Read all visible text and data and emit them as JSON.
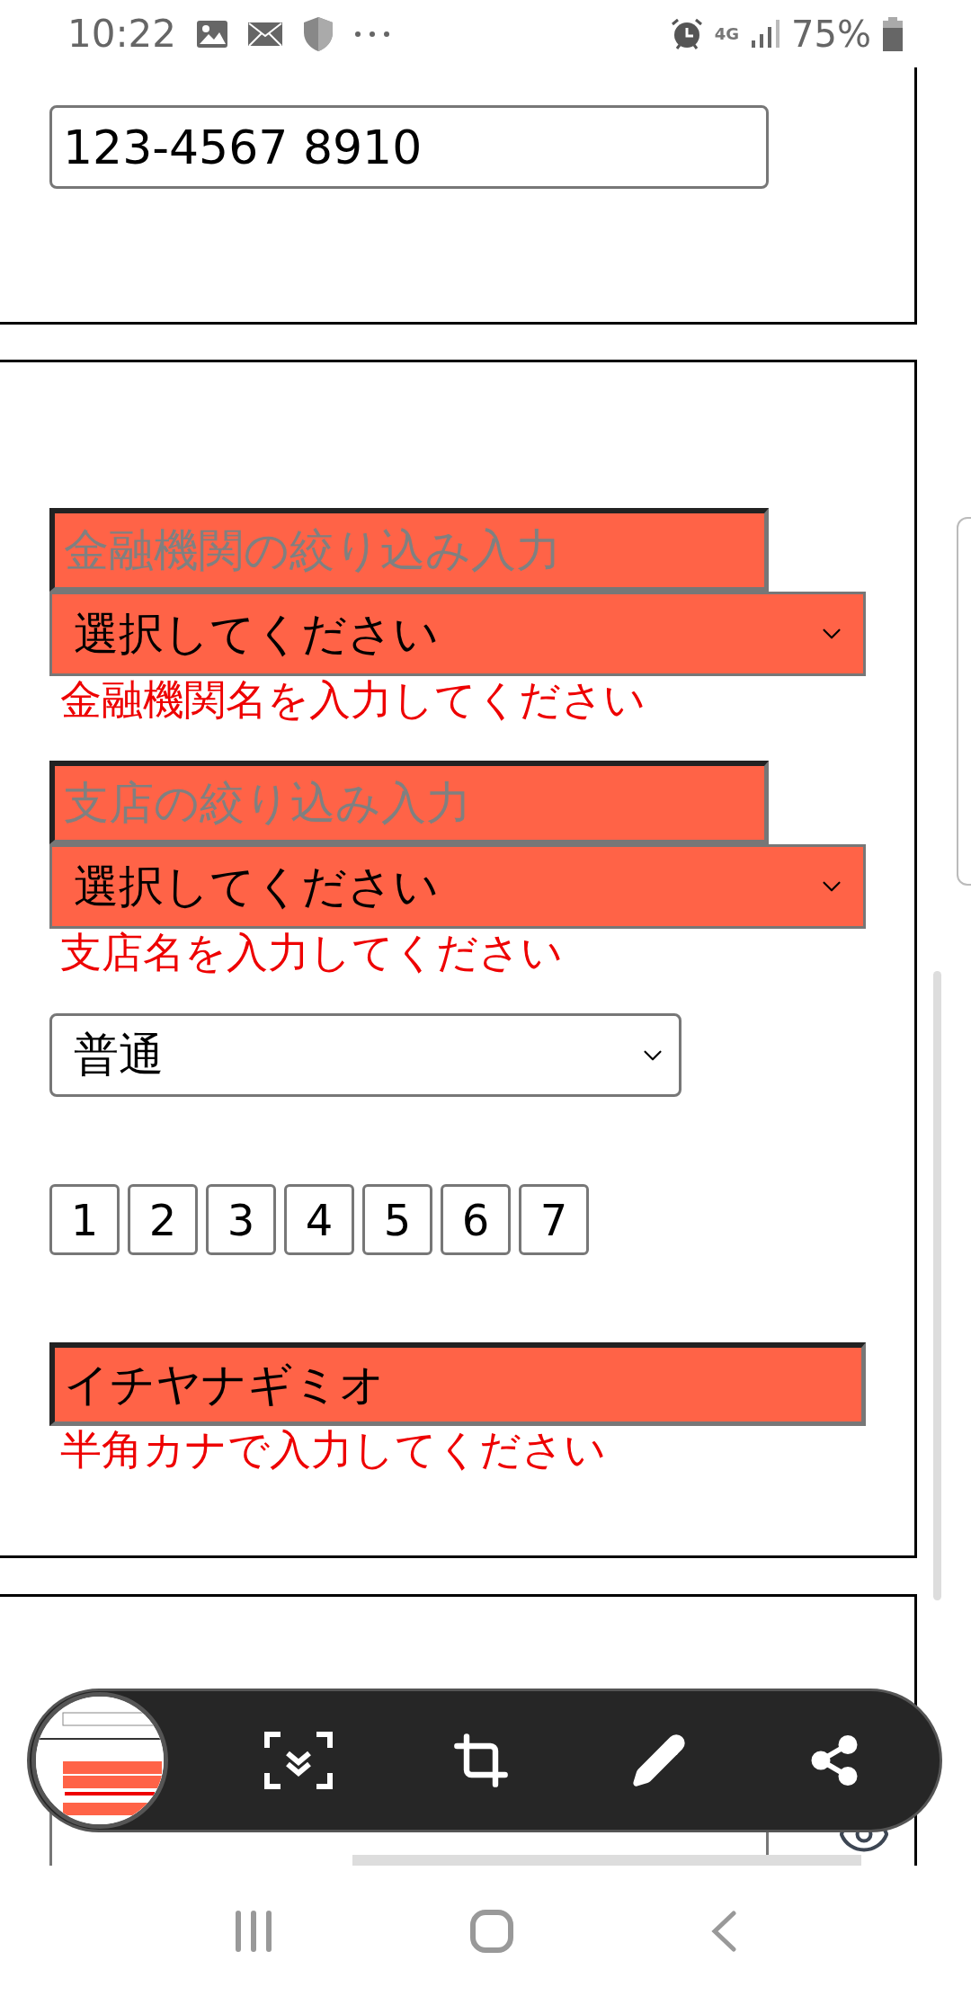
{
  "status_bar": {
    "time": "10:22",
    "network": "4G",
    "battery": "75%"
  },
  "phone_field": {
    "value": "123-4567 8910"
  },
  "account_items": [
    {
      "kind": "filter",
      "placeholder": "金融機関の絞り込み入力",
      "invalid": true
    },
    {
      "kind": "select",
      "value": "選択してください",
      "invalid": true
    },
    {
      "kind": "error",
      "text": "金融機関名を入力してください"
    },
    {
      "kind": "filter",
      "placeholder": "支店の絞り込み入力",
      "invalid": true
    },
    {
      "kind": "select",
      "value": "選択してください",
      "invalid": true
    },
    {
      "kind": "error",
      "text": "支店名を入力してください"
    },
    {
      "kind": "account_type",
      "value": "普通"
    },
    {
      "kind": "digits",
      "values": [
        "1",
        "2",
        "3",
        "4",
        "5",
        "6",
        "7"
      ]
    },
    {
      "kind": "input",
      "value": "イチヤナギミオ",
      "invalid": true
    },
    {
      "kind": "error",
      "text": "半角カナで入力してください"
    }
  ]
}
